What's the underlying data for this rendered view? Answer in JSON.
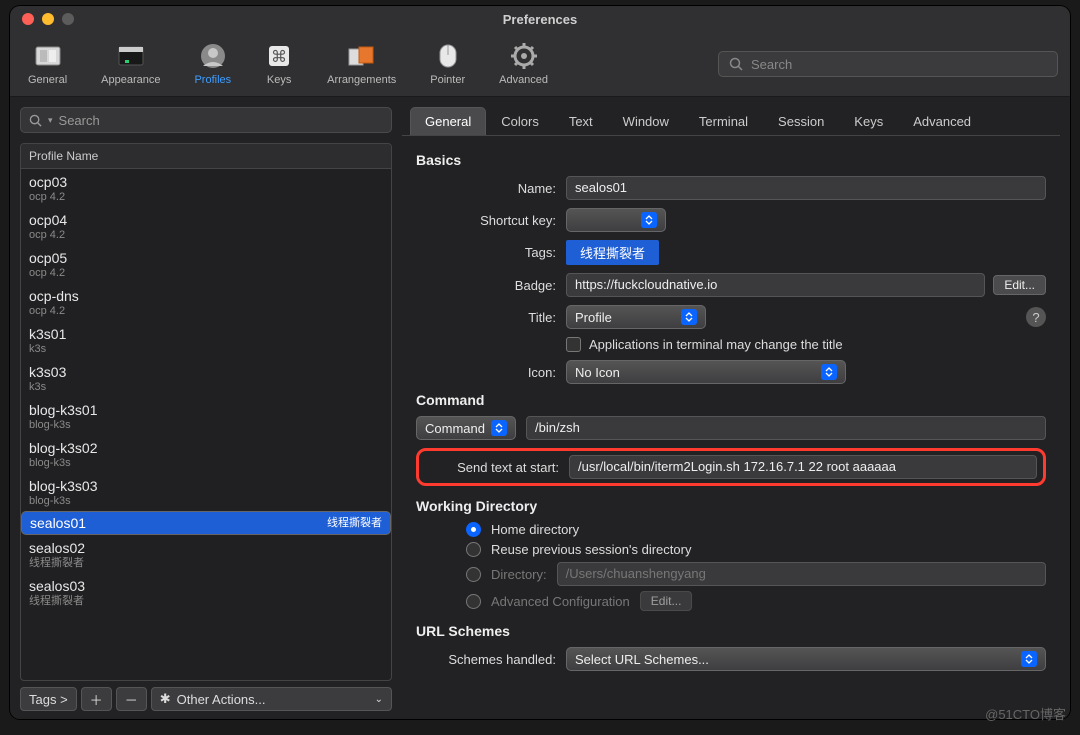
{
  "window": {
    "title": "Preferences"
  },
  "toolbar": {
    "items": [
      {
        "label": "General"
      },
      {
        "label": "Appearance"
      },
      {
        "label": "Profiles"
      },
      {
        "label": "Keys"
      },
      {
        "label": "Arrangements"
      },
      {
        "label": "Pointer"
      },
      {
        "label": "Advanced"
      }
    ],
    "search_placeholder": "Search"
  },
  "sidebar": {
    "search_placeholder": "Search",
    "header": "Profile Name",
    "profiles": [
      {
        "name": "ocp03",
        "tags": "ocp 4.2"
      },
      {
        "name": "ocp04",
        "tags": "ocp 4.2"
      },
      {
        "name": "ocp05",
        "tags": "ocp 4.2"
      },
      {
        "name": "ocp-dns",
        "tags": "ocp 4.2"
      },
      {
        "name": "k3s01",
        "tags": "k3s"
      },
      {
        "name": "k3s03",
        "tags": "k3s"
      },
      {
        "name": "blog-k3s01",
        "tags": "blog-k3s"
      },
      {
        "name": "blog-k3s02",
        "tags": "blog-k3s"
      },
      {
        "name": "blog-k3s03",
        "tags": "blog-k3s"
      },
      {
        "name": "sealos01",
        "tags": "线程撕裂者",
        "selected": true
      },
      {
        "name": "sealos02",
        "tags": "线程撕裂者"
      },
      {
        "name": "sealos03",
        "tags": "线程撕裂者"
      }
    ],
    "footer": {
      "tags_btn": "Tags >",
      "other_actions": "Other Actions..."
    }
  },
  "tabs": [
    "General",
    "Colors",
    "Text",
    "Window",
    "Terminal",
    "Session",
    "Keys",
    "Advanced"
  ],
  "active_tab": 0,
  "basics": {
    "header": "Basics",
    "name_lbl": "Name:",
    "name_val": "sealos01",
    "shortcut_lbl": "Shortcut key:",
    "shortcut_val": "",
    "tags_lbl": "Tags:",
    "tags_val": "线程撕裂者",
    "badge_lbl": "Badge:",
    "badge_val": "https://fuckcloudnative.io",
    "edit_btn": "Edit...",
    "title_lbl": "Title:",
    "title_val": "Profile",
    "apps_cbx_lbl": "Applications in terminal may change the title",
    "icon_lbl": "Icon:",
    "icon_val": "No Icon"
  },
  "command": {
    "header": "Command",
    "mode": "Command",
    "value": "/bin/zsh",
    "send_lbl": "Send text at start:",
    "send_val": "/usr/local/bin/iterm2Login.sh 172.16.7.1 22 root aaaaaa"
  },
  "wd": {
    "header": "Working Directory",
    "home": "Home directory",
    "reuse": "Reuse previous session's directory",
    "dir_lbl": "Directory:",
    "dir_placeholder": "/Users/chuanshengyang",
    "adv": "Advanced Configuration",
    "adv_edit": "Edit..."
  },
  "url": {
    "header": "URL Schemes",
    "lbl": "Schemes handled:",
    "val": "Select URL Schemes..."
  },
  "watermark": "@51CTO博客"
}
